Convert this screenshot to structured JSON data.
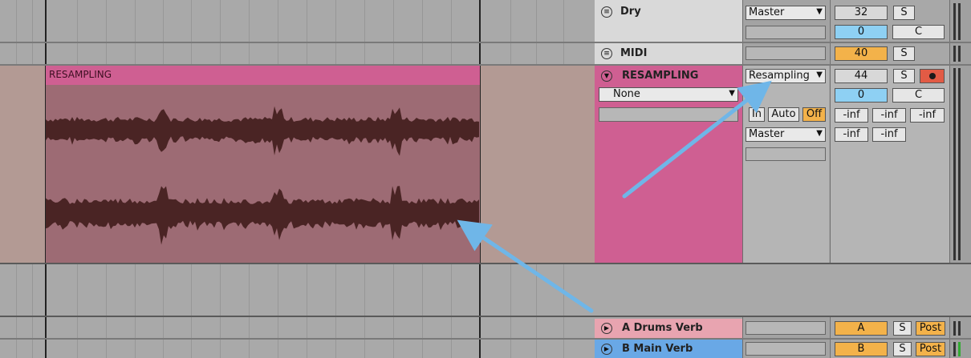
{
  "tracks": [
    {
      "name": "Dry",
      "output": "Master",
      "volume": "32",
      "pan": "0",
      "solo": "S",
      "pan_mode": "C"
    },
    {
      "name": "MIDI",
      "volume": "40",
      "solo": "S"
    },
    {
      "name": "RESAMPLING",
      "input_type": "Resampling",
      "input_channel": "None",
      "monitor": [
        "In",
        "Auto",
        "Off"
      ],
      "output": "Master",
      "volume": "44",
      "pan": "0",
      "solo": "S",
      "pan_mode": "C",
      "sends": [
        "-inf",
        "-inf",
        "-inf"
      ],
      "sends2": [
        "-inf",
        "-inf"
      ]
    },
    {
      "name": "A Drums Verb",
      "letter": "A",
      "solo": "S",
      "mode": "Post"
    },
    {
      "name": "B Main Verb",
      "letter": "B",
      "solo": "S",
      "mode": "Post"
    }
  ],
  "clip": {
    "name": "RESAMPLING"
  },
  "colors": {
    "resampling": "#cf5f92",
    "clip_body": "#9d6b74",
    "arrow": "#6fb6e8",
    "accent": "#f3b24a"
  }
}
